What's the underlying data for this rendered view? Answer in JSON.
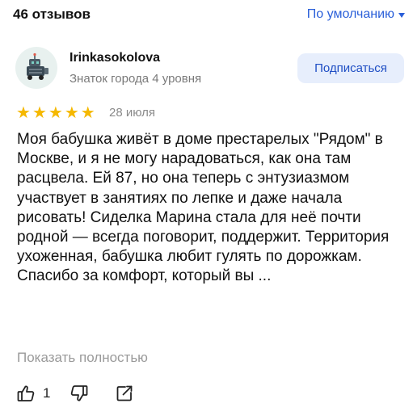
{
  "header": {
    "reviews_count": "46 отзывов",
    "sort_label": "По умолчанию"
  },
  "review": {
    "author": {
      "name": "Irinkasokolova",
      "rank": "Знаток города 4 уровня",
      "avatar_icon": "robot-avatar-icon"
    },
    "subscribe_label": "Подписаться",
    "rating": 5,
    "rating_max": 5,
    "date": "28 июля",
    "text": "Моя бабушка живёт в доме престарелых \"Рядом\" в Москве, и я не могу нарадоваться, как она там расцвела. Ей 87, но она теперь с энтузиазмом участвует в занятиях по лепке и даже начала рисовать! Сиделка Марина стала для неё почти родной — всегда поговорит, поддержит. Территория ухоженная, бабушка любит гулять по дорожкам. Спасибо за комфорт, который вы ...",
    "show_more_label": "Показать полностью",
    "likes": "1"
  },
  "colors": {
    "accent": "#2a5fd9",
    "star": "#f5b800",
    "button_bg": "#e7eefc",
    "muted": "#8a8a8a"
  }
}
